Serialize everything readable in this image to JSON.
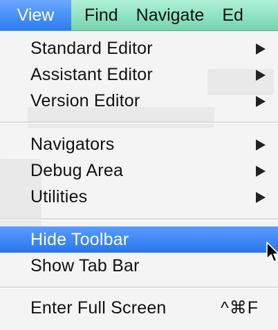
{
  "menubar": {
    "items": [
      {
        "label": "View"
      },
      {
        "label": "Find"
      },
      {
        "label": "Navigate"
      },
      {
        "label": "Ed"
      }
    ]
  },
  "view_menu": {
    "items": [
      {
        "label": "Standard Editor"
      },
      {
        "label": "Assistant Editor"
      },
      {
        "label": "Version Editor"
      },
      {
        "label": "Navigators"
      },
      {
        "label": "Debug Area"
      },
      {
        "label": "Utilities"
      },
      {
        "label": "Hide Toolbar"
      },
      {
        "label": "Show Tab Bar"
      },
      {
        "label": "Enter Full Screen",
        "shortcut": "^⌘F"
      }
    ]
  },
  "colors": {
    "menubar_bg": "#8fe2c1",
    "highlight": "#2c7cf2",
    "menu_bg": "#f4f4f4",
    "text": "#111111"
  },
  "icons": {
    "submenu": "triangle-right-icon",
    "cursor": "mouse-pointer-icon"
  }
}
